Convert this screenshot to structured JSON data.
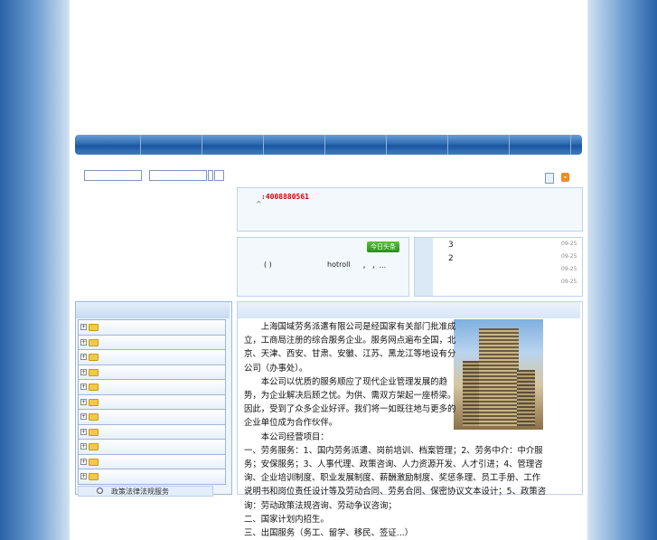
{
  "contact": {
    "phone": ":4008880561",
    "caret": "^"
  },
  "headline": {
    "badge": "今日头条",
    "text_a": "( )",
    "text_b": "hotroll",
    "text_c": "， ，..."
  },
  "news": {
    "items": [
      {
        "num": "3",
        "date": "09-25"
      },
      {
        "num": "2",
        "date": "09-25"
      },
      {
        "num": "",
        "date": "09-25"
      },
      {
        "num": "",
        "date": "09-25"
      }
    ]
  },
  "sidebar": {
    "tree_count_note": "",
    "law_label": "政策法律法规服务"
  },
  "icons": {
    "page": "page-icon",
    "rss": "rss-icon",
    "folder": "folder-icon",
    "expand": "plus-icon",
    "search": "magnifier-icon"
  },
  "main": {
    "paragraphs": [
      "　　上海国域劳务派遣有限公司是经国家有关部门批准成立，工商局注册的综合服务企业。服务网点遍布全国，北京、天津、西安、甘肃、安徽、江苏、黑龙江等地设有分公司（办事处）。",
      "　　本公司以优质的服务顺应了现代企业管理发展的趋势，为企业解决后顾之忧。为供、需双方架起一座桥梁。因此，受到了众多企业好评。我们将一如既往地与更多的企业单位成为合作伙伴。",
      "　　本公司经营项目：",
      "一、劳务服务：1、国内劳务派遣、岗前培训、档案管理；2、劳务中介：中介服务；安保服务；3、人事代理、政策咨询、人力资源开发、人才引进；4、管理咨询、企业培训制度、职业发展制度、薪酬激励制度、奖惩条理、员工手册、工作说明书和岗位责任设计等及劳动合同、劳务合同、保密协议文本设计；5、政策咨询：劳动政策法规咨询、劳动争议咨询；",
      "二、国家计划内招生。",
      "三、出国服务（务工、留学、移民、签证...）"
    ]
  },
  "colors": {
    "nav": "#1b569f",
    "phone": "#d20000",
    "badge": "#2c8d1d"
  }
}
